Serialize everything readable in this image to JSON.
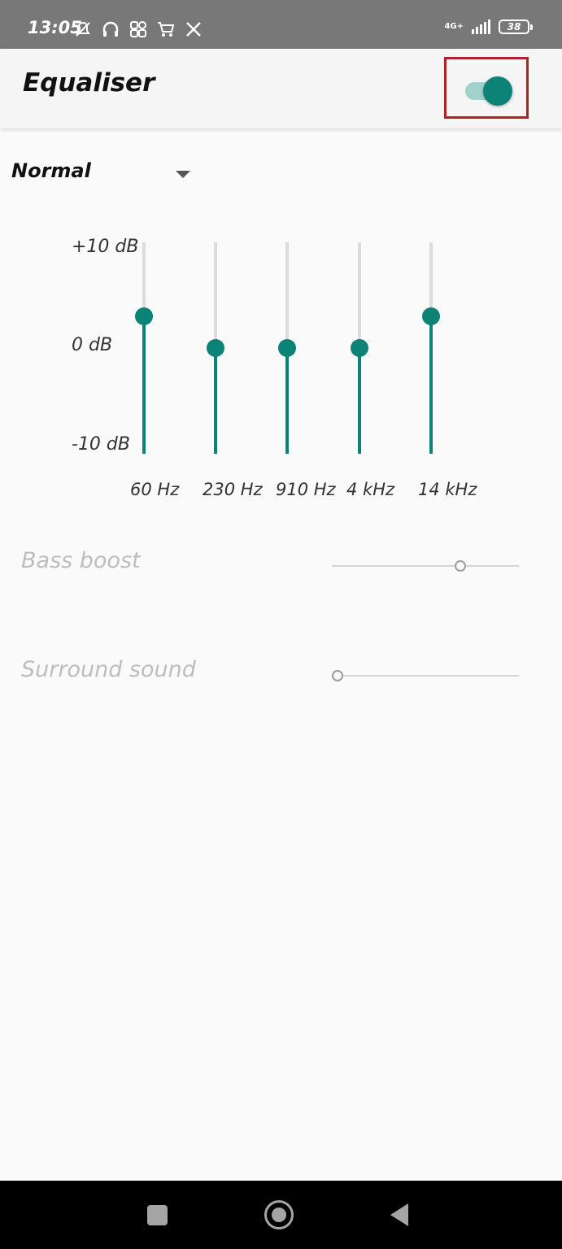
{
  "status_bar": {
    "time": "13:05",
    "network": "4G+",
    "battery": "38",
    "icons": [
      "bell-off-icon",
      "headphones-icon",
      "grid-app-icon",
      "cart-icon",
      "x-logo-icon",
      "signal-icon"
    ]
  },
  "app_bar": {
    "title": "Equaliser",
    "toggle_on": true
  },
  "preset": {
    "selected": "Normal"
  },
  "equaliser": {
    "db_labels": [
      "+10 dB",
      "0 dB",
      "-10 dB"
    ],
    "bands": [
      {
        "freq": "60 Hz",
        "level_db": 3
      },
      {
        "freq": "230 Hz",
        "level_db": 0
      },
      {
        "freq": "910 Hz",
        "level_db": 0
      },
      {
        "freq": "4 kHz",
        "level_db": 0
      },
      {
        "freq": "14 kHz",
        "level_db": 3
      }
    ]
  },
  "effects": {
    "bass_boost": {
      "label": "Bass boost",
      "value": 0.7
    },
    "surround_sound": {
      "label": "Surround sound",
      "value": 0.0
    }
  },
  "colors": {
    "accent": "#0d8377",
    "highlight": "#b0202a",
    "disabled_text": "#bdbdbd"
  }
}
